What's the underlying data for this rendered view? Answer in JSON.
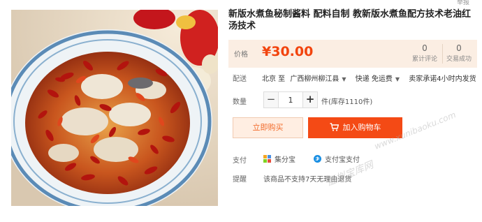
{
  "corner_tag": "举报",
  "product": {
    "title": "新版水煮鱼秘制酱料 配料自制 教新版水煮鱼配方技术老油红汤技术"
  },
  "price": {
    "label": "价格",
    "value": "¥30.00",
    "reviews_count": "0",
    "reviews_label": "累计评论",
    "sales_count": "0",
    "sales_label": "交易成功"
  },
  "shipping": {
    "label": "配送",
    "from": "北京 至",
    "to": "广西柳州柳江县",
    "express": "快递 免运费",
    "promise": "卖家承诺4小时内发货"
  },
  "quantity": {
    "label": "数量",
    "minus": "−",
    "value": "1",
    "plus": "+",
    "stock": "件(库存1110件)"
  },
  "actions": {
    "buy_now": "立即购买",
    "add_to_cart": "加入购物车"
  },
  "payment": {
    "label": "支付",
    "method1": "集分宝",
    "method2": "支付宝支付"
  },
  "notice": {
    "label": "提醒",
    "text": "该商品不支持7天无理由退货"
  },
  "watermark": {
    "url": "www.xunibaoku.com",
    "name": "虚拟宝库网"
  },
  "colors": {
    "accent": "#f44a15",
    "price": "#f2440e",
    "price_bg": "#fbeee3"
  }
}
